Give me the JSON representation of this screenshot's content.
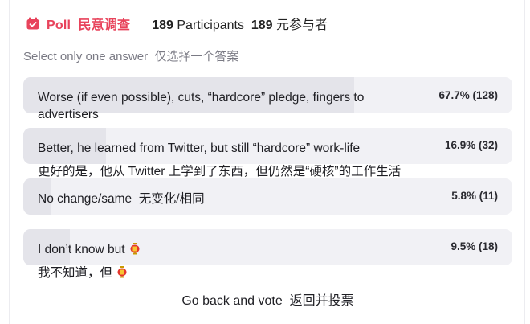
{
  "header": {
    "poll_label": "Poll  民意调查",
    "participants_count": "189",
    "participants_label": " Participants",
    "participants_count_cn": "189",
    "participants_label_cn": " 元参与者",
    "accent_color": "#e8435b"
  },
  "subtitle": "Select only one answer  仅选择一个答案",
  "options": [
    {
      "text": "Worse (if even possible), cuts, “hardcore” pledge, fingers to advertisers",
      "percent_label": "67.7% (128)",
      "fraction": 0.677
    },
    {
      "text": "Better, he learned from Twitter, but still “hardcore” work-life",
      "text_cn": "更好的是，他从 Twitter 上学到了东西，但仍然是“硬核”的工作生活",
      "percent_label": "16.9% (32)",
      "fraction": 0.169
    },
    {
      "text": "No change/same  无变化/相同",
      "percent_label": "5.8% (11)",
      "fraction": 0.058
    },
    {
      "text": "I don’t know but",
      "text_cn": "我不知道，但",
      "percent_label": "9.5% (18)",
      "fraction": 0.095,
      "icon": "lantern-icon"
    }
  ],
  "footer": {
    "back_label": "Go back and vote  返回并投票"
  }
}
